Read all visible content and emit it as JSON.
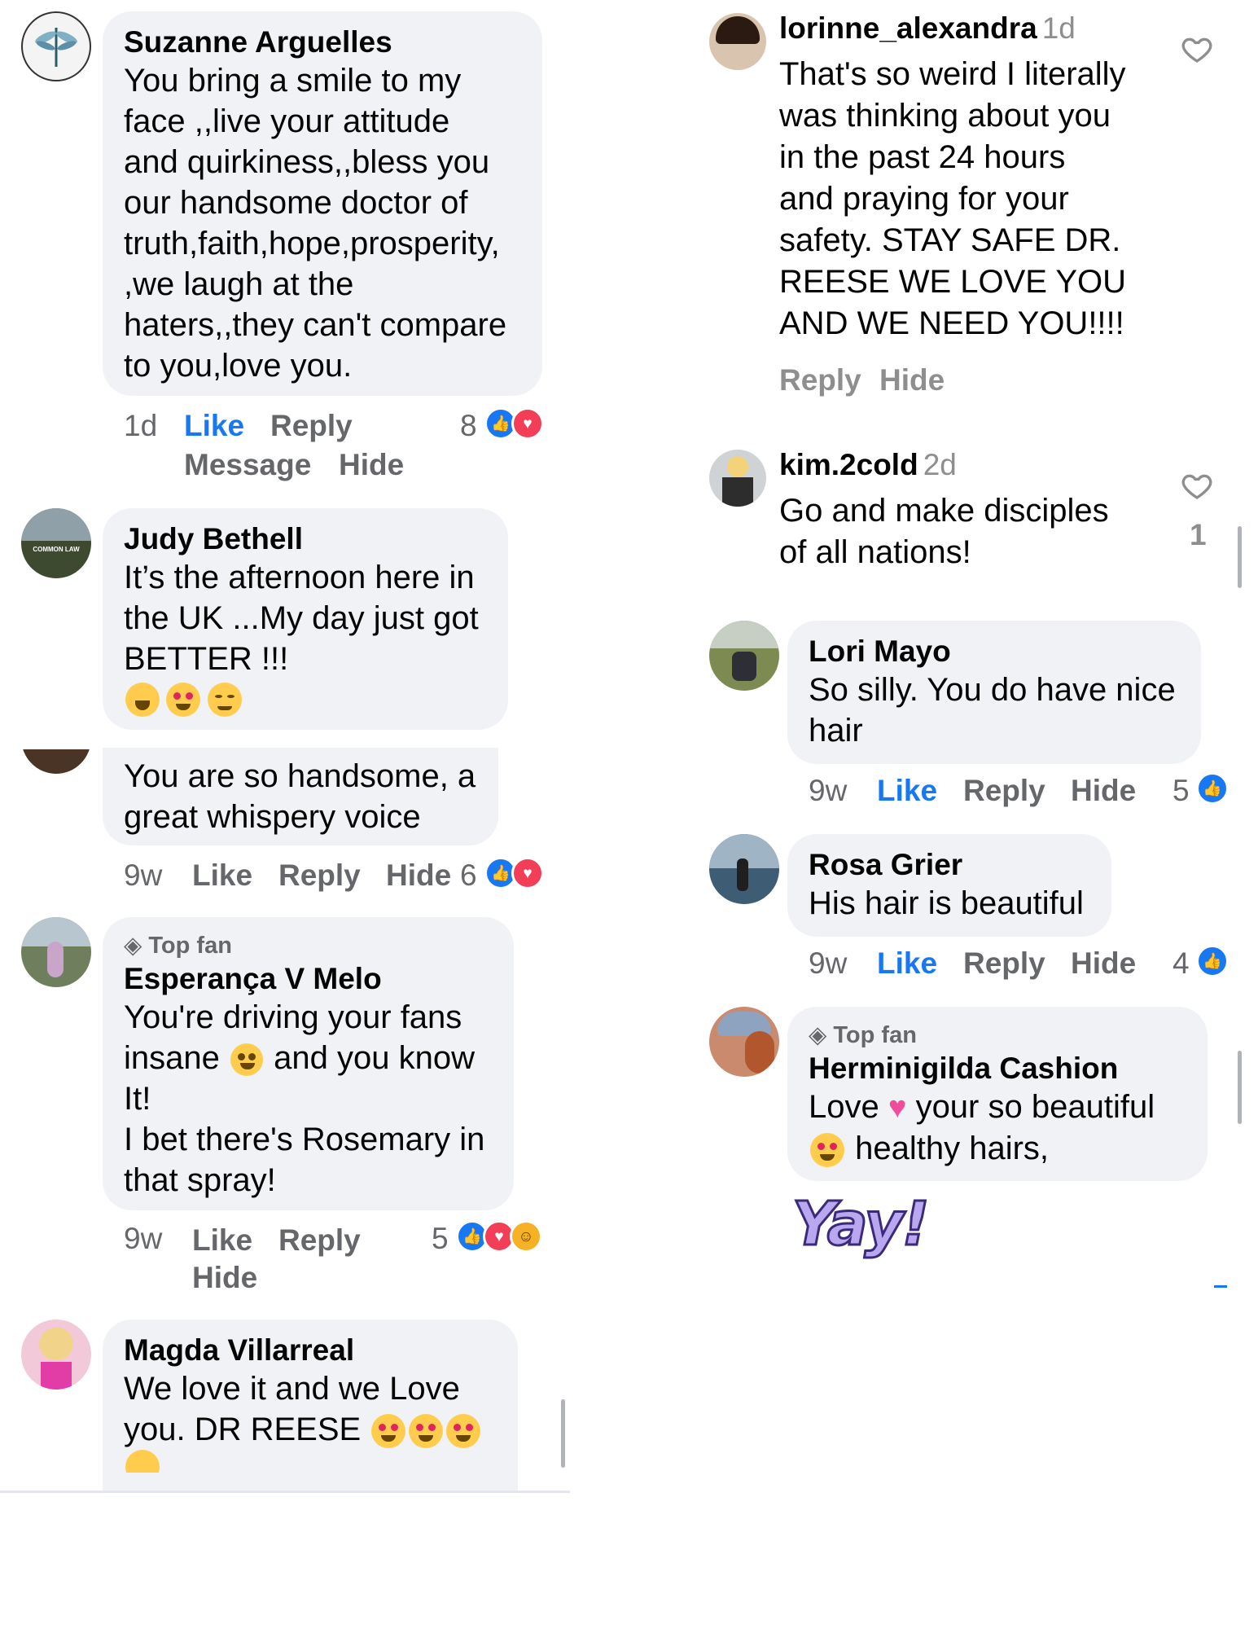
{
  "left": {
    "comments": [
      {
        "author": "Suzanne Arguelles",
        "lines": [
          "You bring a smile to my",
          "face ,,live your attitude",
          "and quirkiness,,bless you",
          "our handsome doctor of",
          "truth,faith,hope,prosperity,",
          ",we laugh at the",
          "haters,,they can't compare",
          "to you,love you."
        ],
        "time": "1d",
        "like": "Like",
        "reply": "Reply",
        "message": "Message",
        "hide": "Hide",
        "count": "8"
      },
      {
        "author": "Judy Bethell",
        "lines": [
          "It’s the afternoon here in",
          "the UK ...My day just got",
          "BETTER !!!"
        ],
        "avatar_text": "COMMON LAW"
      },
      {
        "lines": [
          "You are so handsome, a",
          "great whispery voice"
        ],
        "time": "9w",
        "like": "Like",
        "reply": "Reply",
        "hide": "Hide",
        "count": "6"
      },
      {
        "badge": "Top fan",
        "author": "Esperança V Melo",
        "lines": [
          "You're driving your fans",
          "insane",
          "and you know",
          "It!",
          "I bet there's Rosemary in",
          "that spray!"
        ],
        "time": "9w",
        "like": "Like",
        "reply": "Reply",
        "hide": "Hide",
        "count": "5"
      },
      {
        "author": "Magda Villarreal",
        "lines": [
          "We love  it and we Love",
          "you.   DR REESE"
        ]
      }
    ]
  },
  "right": {
    "instagram": [
      {
        "author": "lorinne_alexandra",
        "time": "1d",
        "lines": [
          "That's so weird I literally",
          "was thinking about you",
          "in the past 24 hours",
          "and praying for your",
          "safety.  STAY SAFE DR.",
          "REESE WE LOVE YOU",
          "AND WE NEED YOU!!!!"
        ],
        "reply": "Reply",
        "hide": "Hide"
      },
      {
        "author": "kim.2cold",
        "time": "2d",
        "lines": [
          "Go and make disciples",
          "of all nations!"
        ],
        "likes": "1"
      }
    ],
    "comments": [
      {
        "author": "Lori Mayo",
        "lines": [
          "So silly. You do have nice",
          "hair"
        ],
        "time": "9w",
        "like": "Like",
        "reply": "Reply",
        "hide": "Hide",
        "count": "5"
      },
      {
        "author": "Rosa Grier",
        "lines": [
          "His hair is beautiful"
        ],
        "time": "9w",
        "like": "Like",
        "reply": "Reply",
        "hide": "Hide",
        "count": "4"
      },
      {
        "badge": "Top fan",
        "author": "Herminigilda Cashion",
        "lines": [
          "Love",
          "your so beautiful",
          "healthy hairs,"
        ],
        "sticker": "Yay!"
      }
    ]
  },
  "icons": {
    "like_reaction": "like-reaction-icon",
    "love_reaction": "love-reaction-icon",
    "haha_reaction": "haha-reaction-icon",
    "heart": "heart-outline-icon",
    "top_fan": "diamond-icon"
  },
  "colors": {
    "bubble": "#f0f2f5",
    "link_blue": "#1877f2",
    "meta_gray": "#65676b",
    "love_red": "#f33e58"
  }
}
